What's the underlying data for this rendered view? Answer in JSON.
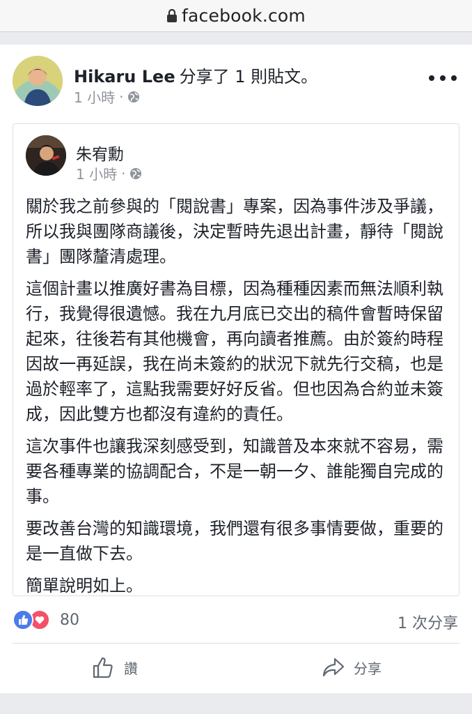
{
  "browser": {
    "url": "facebook.com",
    "icon": "lock-icon"
  },
  "post": {
    "author": "Hikaru Lee",
    "action": "分享了 1 則貼文。",
    "time": "1 小時",
    "separator": "·",
    "privacy_icon": "globe-icon",
    "more_icon": "more-options-icon"
  },
  "shared_post": {
    "author": "朱宥勳",
    "time": "1 小時",
    "separator": "·",
    "paragraphs": [
      "關於我之前參與的「閱說書」專案，因為事件涉及爭議，所以我與團隊商議後，決定暫時先退出計畫，靜待「閱說書」團隊釐清處理。",
      "這個計畫以推廣好書為目標，因為種種因素而無法順利執行，我覺得很遺憾。我在九月底已交出的稿件會暫時保留起來，往後若有其他機會，再向讀者推薦。由於簽約時程因故一再延誤，我在尚未簽約的狀況下就先行交稿，也是過於輕率了，這點我需要好好反省。但也因為合約並未簽成，因此雙方也都沒有違約的責任。",
      "這次事件也讓我深刻感受到，知識普及本來就不容易，需要各種專業的協調配合，不是一朝一夕、誰能獨自完成的事。",
      "要改善台灣的知識環境，我們還有很多事情要做，重要的是一直做下去。",
      "簡單說明如上。"
    ]
  },
  "stats": {
    "reaction_count": "80",
    "share_count": "1 次分享",
    "reaction_icons": [
      "like-reaction-icon",
      "love-reaction-icon"
    ]
  },
  "actions": {
    "like_label": "讚",
    "share_label": "分享"
  },
  "colors": {
    "like_blue": "#4a7dea",
    "love_red": "#f25268",
    "meta_gray": "#90949c"
  }
}
